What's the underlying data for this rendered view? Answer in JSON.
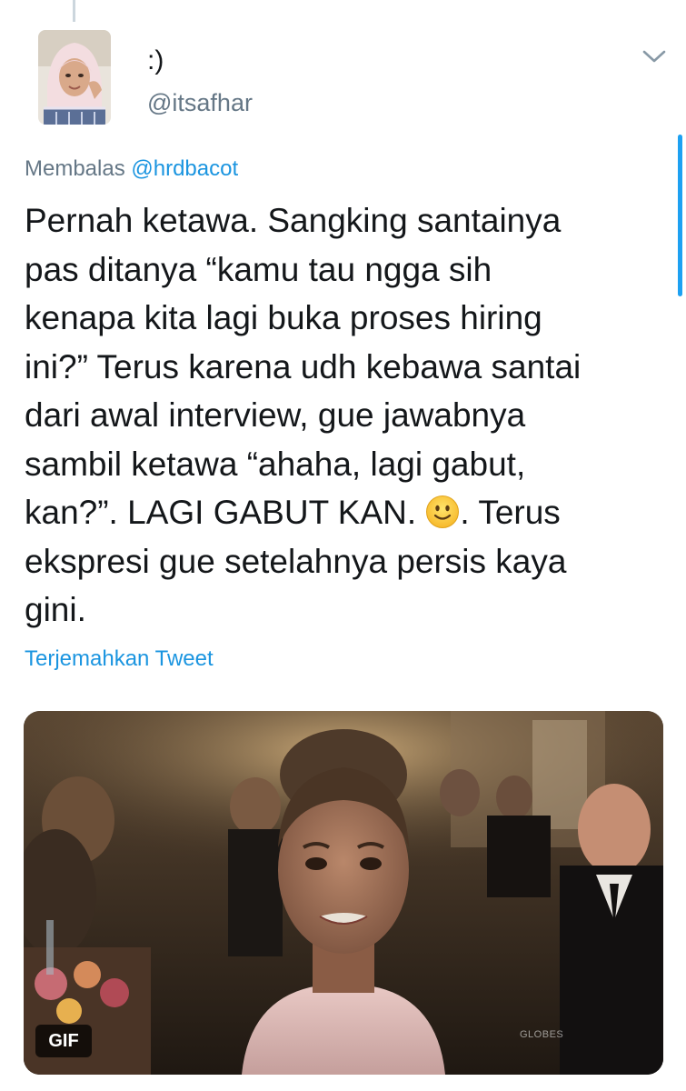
{
  "user": {
    "display_name": ":)",
    "handle": "@itsafhar"
  },
  "reply": {
    "prefix": "Membalas ",
    "mention": "@hrdbacot"
  },
  "tweet": {
    "lines": [
      "Pernah ketawa. Sangking santainya",
      "pas ditanya “kamu tau ngga sih",
      "kenapa kita lagi buka proses hiring",
      "ini?” Terus karena udh kebawa santai",
      "dari awal interview, gue jawabnya",
      "sambil ketawa “ahaha, lagi gabut,",
      "ekspresi gue setelahnya persis kaya",
      "gini."
    ],
    "line7_before_emoji": "kan?”. LAGI GABUT KAN. ",
    "line7_after_emoji": ". Terus",
    "emoji_icon": "slightly-smiling-face-icon"
  },
  "translate_label": "Terjemahkan Tweet",
  "media": {
    "badge": "GIF",
    "watermark": "GLOBES"
  },
  "colors": {
    "link": "#1b95e0",
    "secondary_text": "#657786",
    "primary_text": "#14171a",
    "scrollbar": "#1da1f2",
    "thread_line": "#ccd6dd"
  }
}
